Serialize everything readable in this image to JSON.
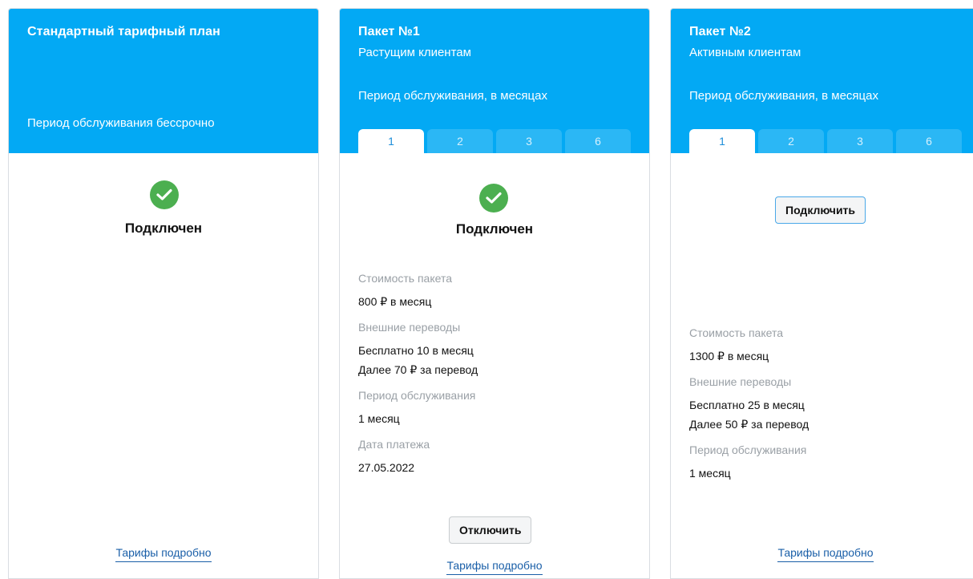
{
  "colors": {
    "header_bg": "#03a9f4",
    "tab_inactive_bg": "#2bb7f5",
    "tab_active_bg": "#ffffff",
    "status_green": "#4caf50",
    "link": "#1a5fa8",
    "muted_label": "#9aa0a6"
  },
  "standard": {
    "title": "Стандартный тарифный план",
    "period": "Период обслуживания бессрочно",
    "status": "Подключен",
    "status_icon": "check-circle-icon",
    "more_link": "Тарифы подробно"
  },
  "package1": {
    "title": "Пакет №1",
    "subtitle": "Растущим клиентам",
    "period_label": "Период обслуживания, в месяцах",
    "tabs": [
      "1",
      "2",
      "3",
      "6"
    ],
    "active_tab": "1",
    "status": "Подключен",
    "status_icon": "check-circle-icon",
    "cost_label": "Стоимость пакета",
    "cost_value": "800 ₽ в месяц",
    "transfers_label": "Внешние переводы",
    "transfers_free": "Бесплатно 10 в месяц",
    "transfers_after": "Далее 70 ₽ за перевод",
    "service_period_label": "Период обслуживания",
    "service_period_value": "1 месяц",
    "payment_date_label": "Дата платежа",
    "payment_date_value": "27.05.2022",
    "disconnect_button": "Отключить",
    "more_link": "Тарифы подробно"
  },
  "package2": {
    "title": "Пакет №2",
    "subtitle": "Активным клиентам",
    "period_label": "Период обслуживания, в месяцах",
    "tabs": [
      "1",
      "2",
      "3",
      "6"
    ],
    "active_tab": "1",
    "connect_button": "Подключить",
    "cost_label": "Стоимость пакета",
    "cost_value": "1300 ₽ в месяц",
    "transfers_label": "Внешние переводы",
    "transfers_free": "Бесплатно 25 в месяц",
    "transfers_after": "Далее 50 ₽ за перевод",
    "service_period_label": "Период обслуживания",
    "service_period_value": "1 месяц",
    "more_link": "Тарифы подробно"
  }
}
